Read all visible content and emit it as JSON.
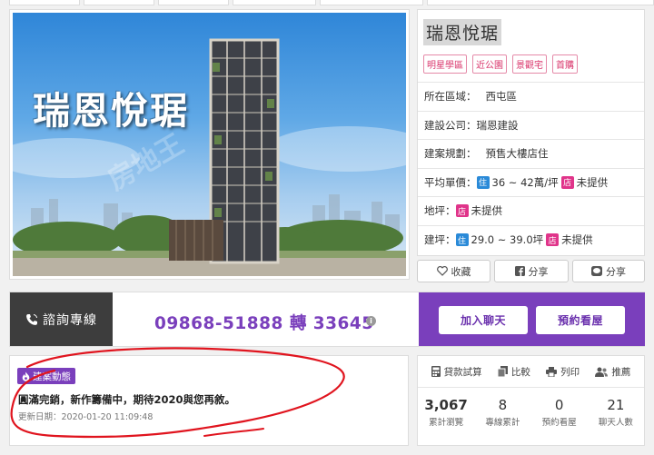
{
  "hero": {
    "title": "瑞恩悅琚",
    "watermark": "房地王"
  },
  "project": {
    "name": "瑞恩悅琚",
    "tags": [
      "明星學區",
      "近公園",
      "景觀宅",
      "首購"
    ],
    "rows": {
      "district": {
        "label": "所在區域：",
        "value": "西屯區"
      },
      "builder": {
        "label": "建設公司：",
        "value": "瑞恩建設"
      },
      "plan": {
        "label": "建案規劃：",
        "value": "預售大樓店住"
      },
      "price": {
        "label": "平均單價：",
        "badge1": "住",
        "value1": "36 ~ 42萬/坪",
        "badge2": "店",
        "value2": "未提供"
      },
      "land": {
        "label": "地坪：",
        "badge": "店",
        "value": "未提供"
      },
      "building": {
        "label": "建坪：",
        "badge1": "住",
        "value1": "29.0 ~ 39.0坪",
        "badge2": "店",
        "value2": "未提供"
      }
    }
  },
  "share": {
    "favorite": "收藏",
    "facebook": "分享",
    "line": "分享"
  },
  "contact": {
    "label": "諮詢專線",
    "phone": "09868-51888 轉 33645",
    "info_icon": "i",
    "join_chat": "加入聊天",
    "book_visit": "預約看屋"
  },
  "news": {
    "badge": "建案動態",
    "text": "圓滿完銷，新作籌備中，期待2020與您再敘。",
    "date": "更新日期：2020-01-20 11:09:48"
  },
  "tools": {
    "loan": "貸款試算",
    "compare": "比較",
    "print": "列印",
    "recommend": "推薦"
  },
  "stats": [
    {
      "value": "3,067",
      "label": "累計瀏覽"
    },
    {
      "value": "8",
      "label": "專線累計"
    },
    {
      "value": "0",
      "label": "預約看屋"
    },
    {
      "value": "21",
      "label": "聊天人數"
    }
  ],
  "colors": {
    "accent": "#7a3fbc",
    "tag": "#d9356b",
    "badge_residential": "#2a8ad8",
    "badge_shop": "#e0348a",
    "annotation": "#e0141e"
  }
}
